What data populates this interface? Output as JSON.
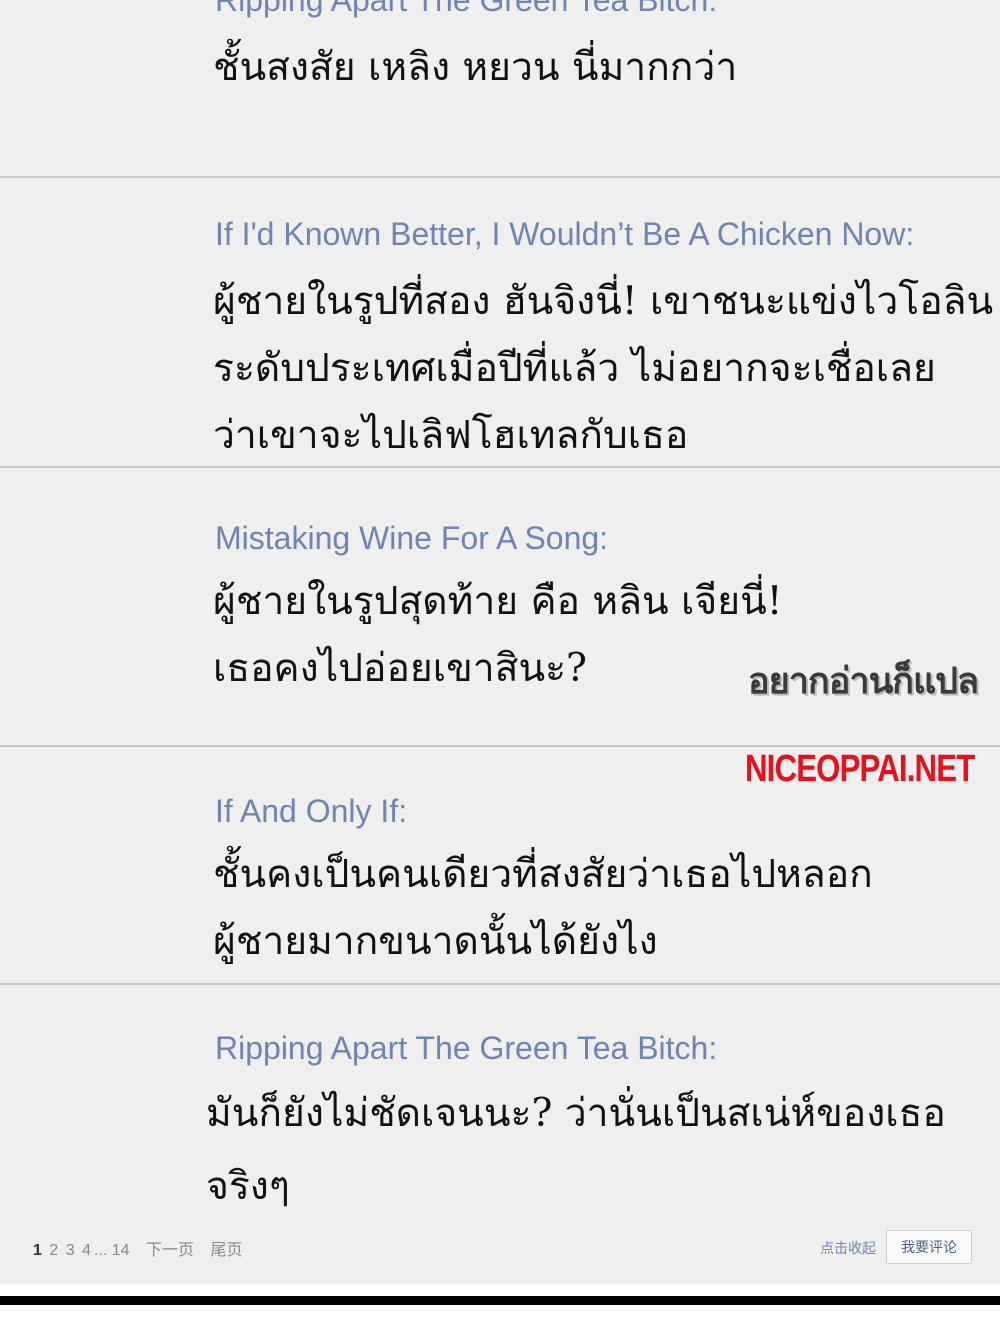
{
  "comments": [
    {
      "author": "Ripping Apart The Green Tea Bitch:",
      "lines": [
        "ชั้นสงสัย เหลิง หยวน นี่มากกว่า"
      ]
    },
    {
      "author": "If I'd Known Better, I Wouldn’t Be A Chicken Now:",
      "lines": [
        "ผู้ชายในรูปที่สอง ฮันจิงนี่! เขาชนะแข่งไวโอลิน",
        "ระดับประเทศเมื่อปีที่แล้ว ไม่อยากจะเชื่อเลย",
        "ว่าเขาจะไปเลิฟโฮเทลกับเธอ"
      ]
    },
    {
      "author": "Mistaking Wine For A Song:",
      "lines": [
        " ผู้ชายในรูปสุดท้าย คือ หลิน เจียนี่!",
        "เธอคงไปอ่อยเขาสินะ?"
      ]
    },
    {
      "author": "If And Only If:",
      "lines": [
        "ชั้นคงเป็นคนเดียวที่สงสัยว่าเธอไปหลอก",
        "ผู้ชายมากขนาดนั้นได้ยังไง"
      ]
    },
    {
      "author": "Ripping Apart The Green Tea Bitch:",
      "lines": [
        "มันก็ยังไม่ชัดเจนนะ? ว่านั่นเป็นสเน่ห์ของเธอ",
        "จริงๆ"
      ]
    }
  ],
  "watermarks": {
    "translator": "อยากอ่านก็แปล",
    "site": "NICEOPPAI.NET"
  },
  "pagination": {
    "pages": [
      "1",
      "2",
      "3",
      "4"
    ],
    "ellipsis": "...",
    "last_page": "14",
    "next_label": "下一页",
    "end_label": "尾页"
  },
  "actions": {
    "favorite_label": "点击收起",
    "comment_label": "我要评论"
  },
  "colors": {
    "author": "#6e84b4",
    "site_watermark": "#e8101a",
    "background": "#efefef"
  }
}
